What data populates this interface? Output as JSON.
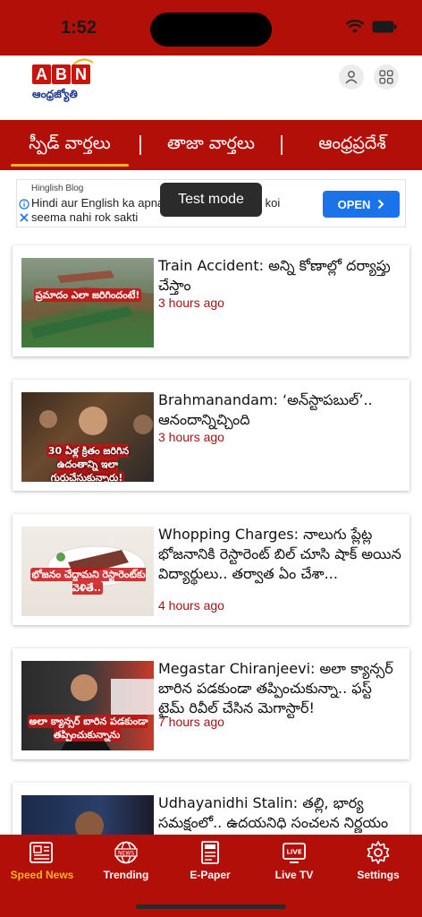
{
  "status_bar": {
    "time": "1:52"
  },
  "header": {
    "logo_letters": [
      "A",
      "B",
      "N"
    ],
    "logo_subtitle": "ఆంధ్రజ్యోతి",
    "profile_icon": "user-icon",
    "menu_icon": "grid-icon"
  },
  "tabs": [
    {
      "label": "స్పీడ్ వార్తలు",
      "active": true
    },
    {
      "label": "తాజా వార్తలు",
      "active": false
    },
    {
      "label": "ఆంధ్రప్రదేశ్",
      "active": false
    }
  ],
  "ad": {
    "source": "Hinglish Blog",
    "text": "Hindi aur English ka apna yahaan bhasha ko koi seema nahi rok sakti",
    "cta": "OPEN"
  },
  "toast": "Test mode",
  "articles": [
    {
      "title": "Train Accident: అన్ని కోణాల్లో దర్యాప్తు చేస్తాం",
      "time": "3 hours ago",
      "thumb_caption": "ప్రమాదం ఎలా జరిగిందంటే!"
    },
    {
      "title": "Brahmanandam: ‘అన్‌స్టాపబుల్’.. ఆనందాన్నిచ్చింది",
      "time": "3 hours ago",
      "thumb_caption": "30 ఏళ్ల క్రితం జరిగిన ఉదంతాన్ని ఇలా గుర్తుచేసుకున్నారు!"
    },
    {
      "title": "Whopping Charges: నాలుగు ప్లేట్ల భోజనానికి రెస్టారెంట్ బిల్ చూసి షాక్ అయిన విద్యార్థులు.. తర్వాత ఏం చేశా...",
      "time": "4 hours ago",
      "thumb_caption": "భోజనం చేద్దామని రెస్టారెంట్‌కు వెళితే.."
    },
    {
      "title": "Megastar Chiranjeevi: అలా క్యాన్సర్ బారిన పడకుండా తప్పించుకున్నా.. ఫస్ట్ టైమ్ రివీల్ చేసిన మెగాస్టార్!",
      "time": "7 hours ago",
      "thumb_caption": "అలా క్యాన్సర్ బారిన పడకుండా తప్పించుకున్నాను"
    },
    {
      "title": "Udhayanidhi Stalin: తల్లి, భార్య సమక్షంలో.. ఉదయనిధి సంచలన నిర్ణయం",
      "time": "",
      "thumb_caption": ""
    }
  ],
  "bottom_nav": [
    {
      "label": "Speed News",
      "icon": "newspaper-icon",
      "active": true
    },
    {
      "label": "Trending",
      "icon": "globe-news-icon",
      "active": false
    },
    {
      "label": "E-Paper",
      "icon": "epaper-icon",
      "active": false
    },
    {
      "label": "Live TV",
      "icon": "live-tv-icon",
      "active": false
    },
    {
      "label": "Settings",
      "icon": "gear-icon",
      "active": false
    }
  ],
  "colors": {
    "brand_red": "#b10f08",
    "active_accent": "#f6b418",
    "time_text": "#a31515",
    "ad_button": "#1a73e8"
  }
}
